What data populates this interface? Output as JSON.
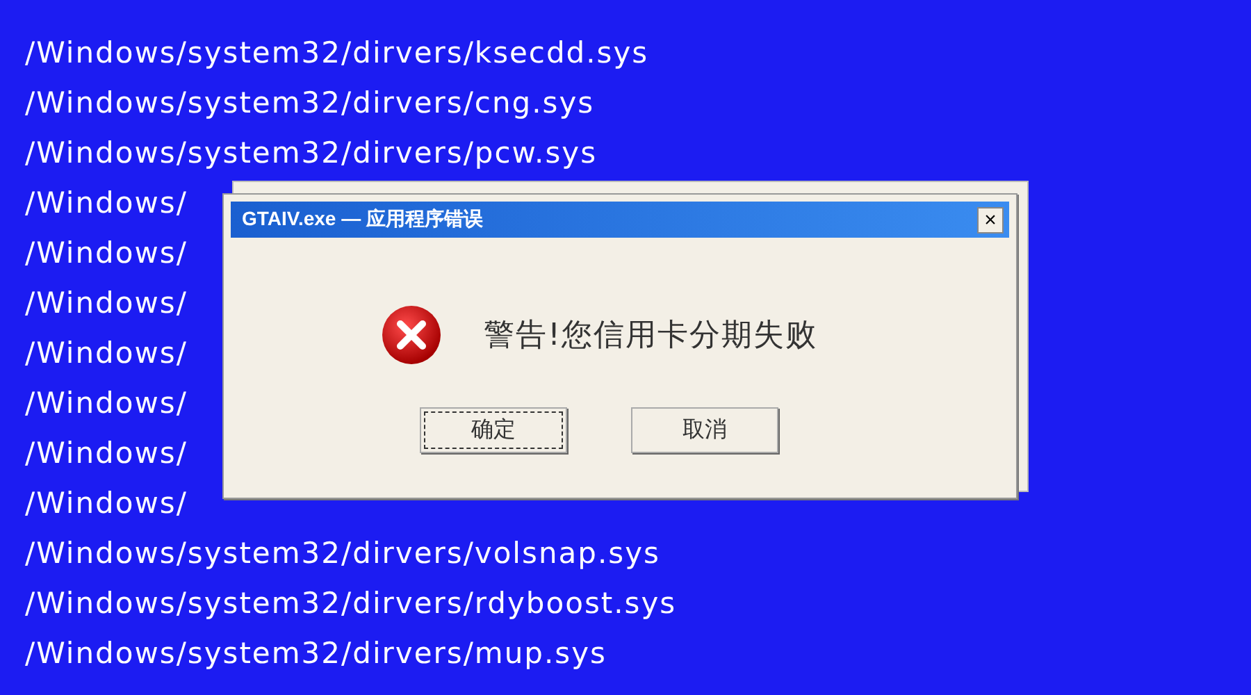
{
  "lines": [
    "/Windows/system32/dirvers/ksecdd.sys",
    "/Windows/system32/dirvers/cng.sys",
    "/Windows/system32/dirvers/pcw.sys",
    "/Windows/",
    "/Windows/",
    "/Windows/",
    "/Windows/",
    "/Windows/",
    "/Windows/",
    "/Windows/",
    "/Windows/system32/dirvers/volsnap.sys",
    "/Windows/system32/dirvers/rdyboost.sys",
    "/Windows/system32/dirvers/mup.sys"
  ],
  "dialog": {
    "title": "GTAIV.exe — 应用程序错误",
    "close": "×",
    "message": "警告!您信用卡分期失败",
    "buttons": [
      {
        "label": "确定",
        "focused": true
      },
      {
        "label": "取消",
        "focused": false
      }
    ]
  }
}
